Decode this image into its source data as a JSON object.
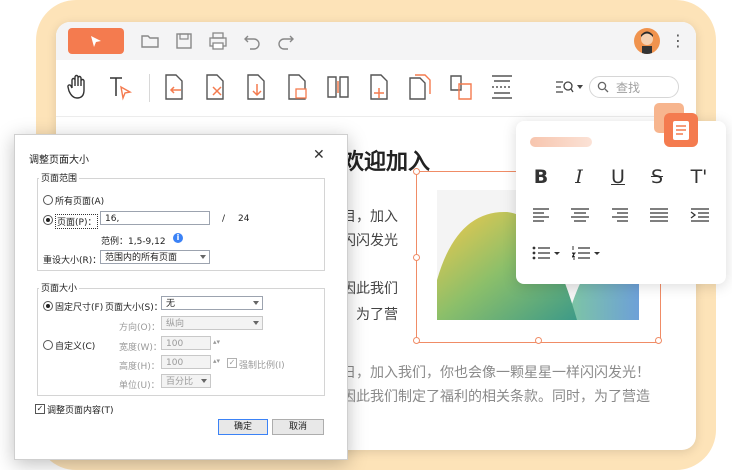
{
  "search": {
    "placeholder": "查找"
  },
  "document": {
    "title": "欢迎加入",
    "lines": [
      "！",
      "目，加入",
      "闪闪发光",
      "因此我们",
      "，为了营",
      "！",
      "日，加入我们，你也会像一颗星星一样闪闪发光！",
      "因此我们制定了福利的相关条款。同时，为了营造"
    ]
  },
  "dialog": {
    "title": "调整页面大小",
    "page_range": {
      "group_label": "页面范围",
      "all_pages": "所有页面(A)",
      "pages_label": "页面(P)：",
      "pages_value": "16,",
      "slash": "/",
      "total": "24",
      "example": "范例：1,5-9,12",
      "resize_label": "重设大小(R)：",
      "resize_value": "范围内的所有页面"
    },
    "page_size": {
      "group_label": "页面大小",
      "fixed_size": "固定尺寸(F)",
      "size_label": "页面大小(S)：",
      "size_value": "无",
      "orientation_label": "方向(O)：",
      "orientation_value": "纵向",
      "custom": "自定义(C)",
      "width_label": "宽度(W)：",
      "width_value": "100",
      "height_label": "高度(H)：",
      "height_value": "100",
      "lock_ratio": "强制比例(I)",
      "unit_label": "单位(U)：",
      "unit_value": "百分比"
    },
    "adjust_content": "调整页面内容(T)",
    "ok": "确定",
    "cancel": "取消"
  },
  "colors": {
    "accent": "#f47b4f",
    "frame": "#fde3b8",
    "selection": "#f08c66",
    "link_blue": "#3b82f6"
  }
}
